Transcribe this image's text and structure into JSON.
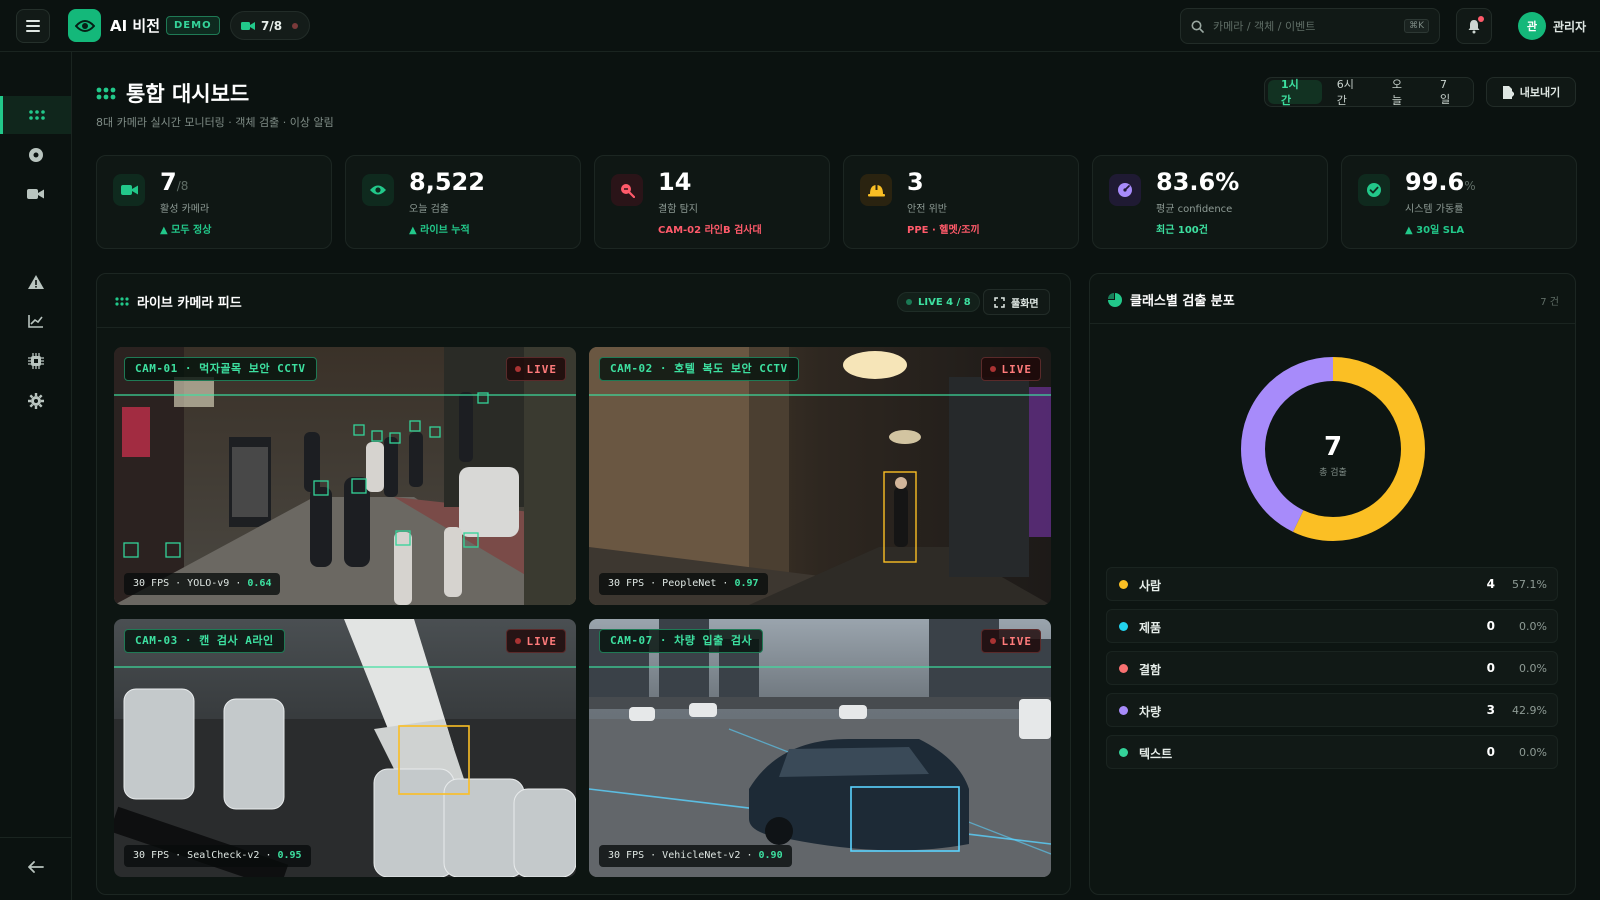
{
  "app": {
    "brand": "AI 비전",
    "demo_badge": "DEMO",
    "camera_chip": "7/8"
  },
  "search": {
    "placeholder": "카메라 / 객체 / 이벤트",
    "shortcut": "⌘K"
  },
  "user": {
    "avatar": "관",
    "name": "관리자"
  },
  "page": {
    "title": "통합 대시보드",
    "subtitle": "8대 카메라 실시간 모니터링 · 객체 검출 · 이상 알림"
  },
  "time_range": {
    "options": [
      "1시간",
      "6시간",
      "오늘",
      "7일"
    ],
    "selected": "1시간"
  },
  "export_label": "내보내기",
  "kpis": [
    {
      "value": "7",
      "suffix": "/8",
      "label": "활성 카메라",
      "trend": "▲ 모두 정상",
      "icon": "camera-icon",
      "color": "#22c88a"
    },
    {
      "value": "8,522",
      "suffix": "",
      "label": "오늘 검출",
      "trend": "▲ 라이브 누적",
      "icon": "eye-icon",
      "color": "#22c88a"
    },
    {
      "value": "14",
      "suffix": "",
      "label": "결함 탐지",
      "trend": "CAM-02 라인B 검사대",
      "icon": "defect-search-icon",
      "color": "#ff5a6a"
    },
    {
      "value": "3",
      "suffix": "",
      "label": "안전 위반",
      "trend": "PPE · 헬멧/조끼",
      "icon": "helmet-icon",
      "color": "#ff5a6a"
    },
    {
      "value": "83.6%",
      "suffix": "",
      "label": "평균 confidence",
      "trend": "최근 100건",
      "icon": "gauge-icon",
      "color": "#3de0a0"
    },
    {
      "value": "99.6",
      "suffix": "%",
      "label": "시스템 가동률",
      "trend": "▲ 30일 SLA",
      "icon": "check-circle-icon",
      "color": "#3de0a0"
    }
  ],
  "live_panel": {
    "title": "라이브 카메라 피드",
    "live_count": "LIVE 4 / 8",
    "fullscreen_label": "풀화면"
  },
  "feeds": [
    {
      "cam": "CAM-01 · 먹자골목 보안 CCTV",
      "live": "LIVE",
      "fps": "30 FPS · YOLO-v9 · ",
      "conf": "0.64"
    },
    {
      "cam": "CAM-02 · 호텔 복도 보안 CCTV",
      "live": "LIVE",
      "fps": "30 FPS · PeopleNet · ",
      "conf": "0.97"
    },
    {
      "cam": "CAM-03 · 캔 검사 A라인",
      "live": "LIVE",
      "fps": "30 FPS · SealCheck-v2 · ",
      "conf": "0.95"
    },
    {
      "cam": "CAM-07 · 차량 입출 검사",
      "live": "LIVE",
      "fps": "30 FPS · VehicleNet-v2 · ",
      "conf": "0.90"
    }
  ],
  "class_panel": {
    "title": "클래스별 검출 분포",
    "count_label": "7 건",
    "total": "7",
    "total_label": "총 검출",
    "classes": [
      {
        "name": "사람",
        "count": 4,
        "pct": "57.1%",
        "color": "#fbbf24"
      },
      {
        "name": "제품",
        "count": 0,
        "pct": "0.0%",
        "color": "#22d3ee"
      },
      {
        "name": "결함",
        "count": 0,
        "pct": "0.0%",
        "color": "#f87171"
      },
      {
        "name": "차량",
        "count": 3,
        "pct": "42.9%",
        "color": "#a78bfa"
      },
      {
        "name": "텍스트",
        "count": 0,
        "pct": "0.0%",
        "color": "#34d399"
      }
    ]
  }
}
